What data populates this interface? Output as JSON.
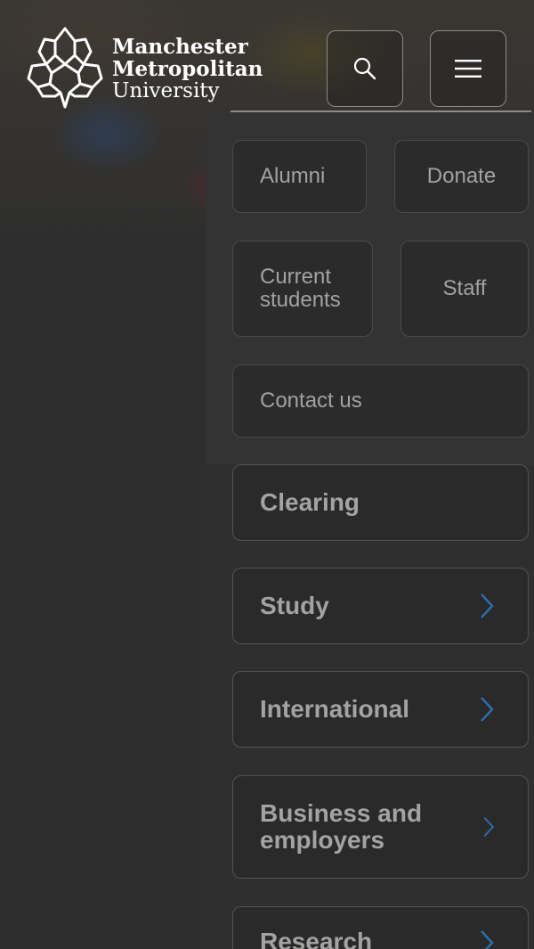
{
  "brand": {
    "line1": "Manchester",
    "line2": "Metropolitan",
    "line3": "University"
  },
  "header": {
    "search_icon": "search-icon",
    "menu_icon": "hamburger-menu-icon"
  },
  "utility_links": [
    {
      "label": "Alumni"
    },
    {
      "label": "Donate"
    },
    {
      "label": "Current students"
    },
    {
      "label": "Staff"
    },
    {
      "label": "Contact us"
    }
  ],
  "current_students": {
    "line1": "Current",
    "line2": "students"
  },
  "nav_items": [
    {
      "label": "Clearing",
      "has_submenu": false
    },
    {
      "label": "Study",
      "has_submenu": true
    },
    {
      "label": "International",
      "has_submenu": true
    },
    {
      "label": "Business and employers",
      "line1": "Business and",
      "line2": "employers",
      "has_submenu": true
    },
    {
      "label": "Research",
      "has_submenu": true
    }
  ],
  "colors": {
    "background": "#2e2e2e",
    "accent_chevron": "#2a6fb0",
    "text_muted": "#a3a3a1"
  }
}
